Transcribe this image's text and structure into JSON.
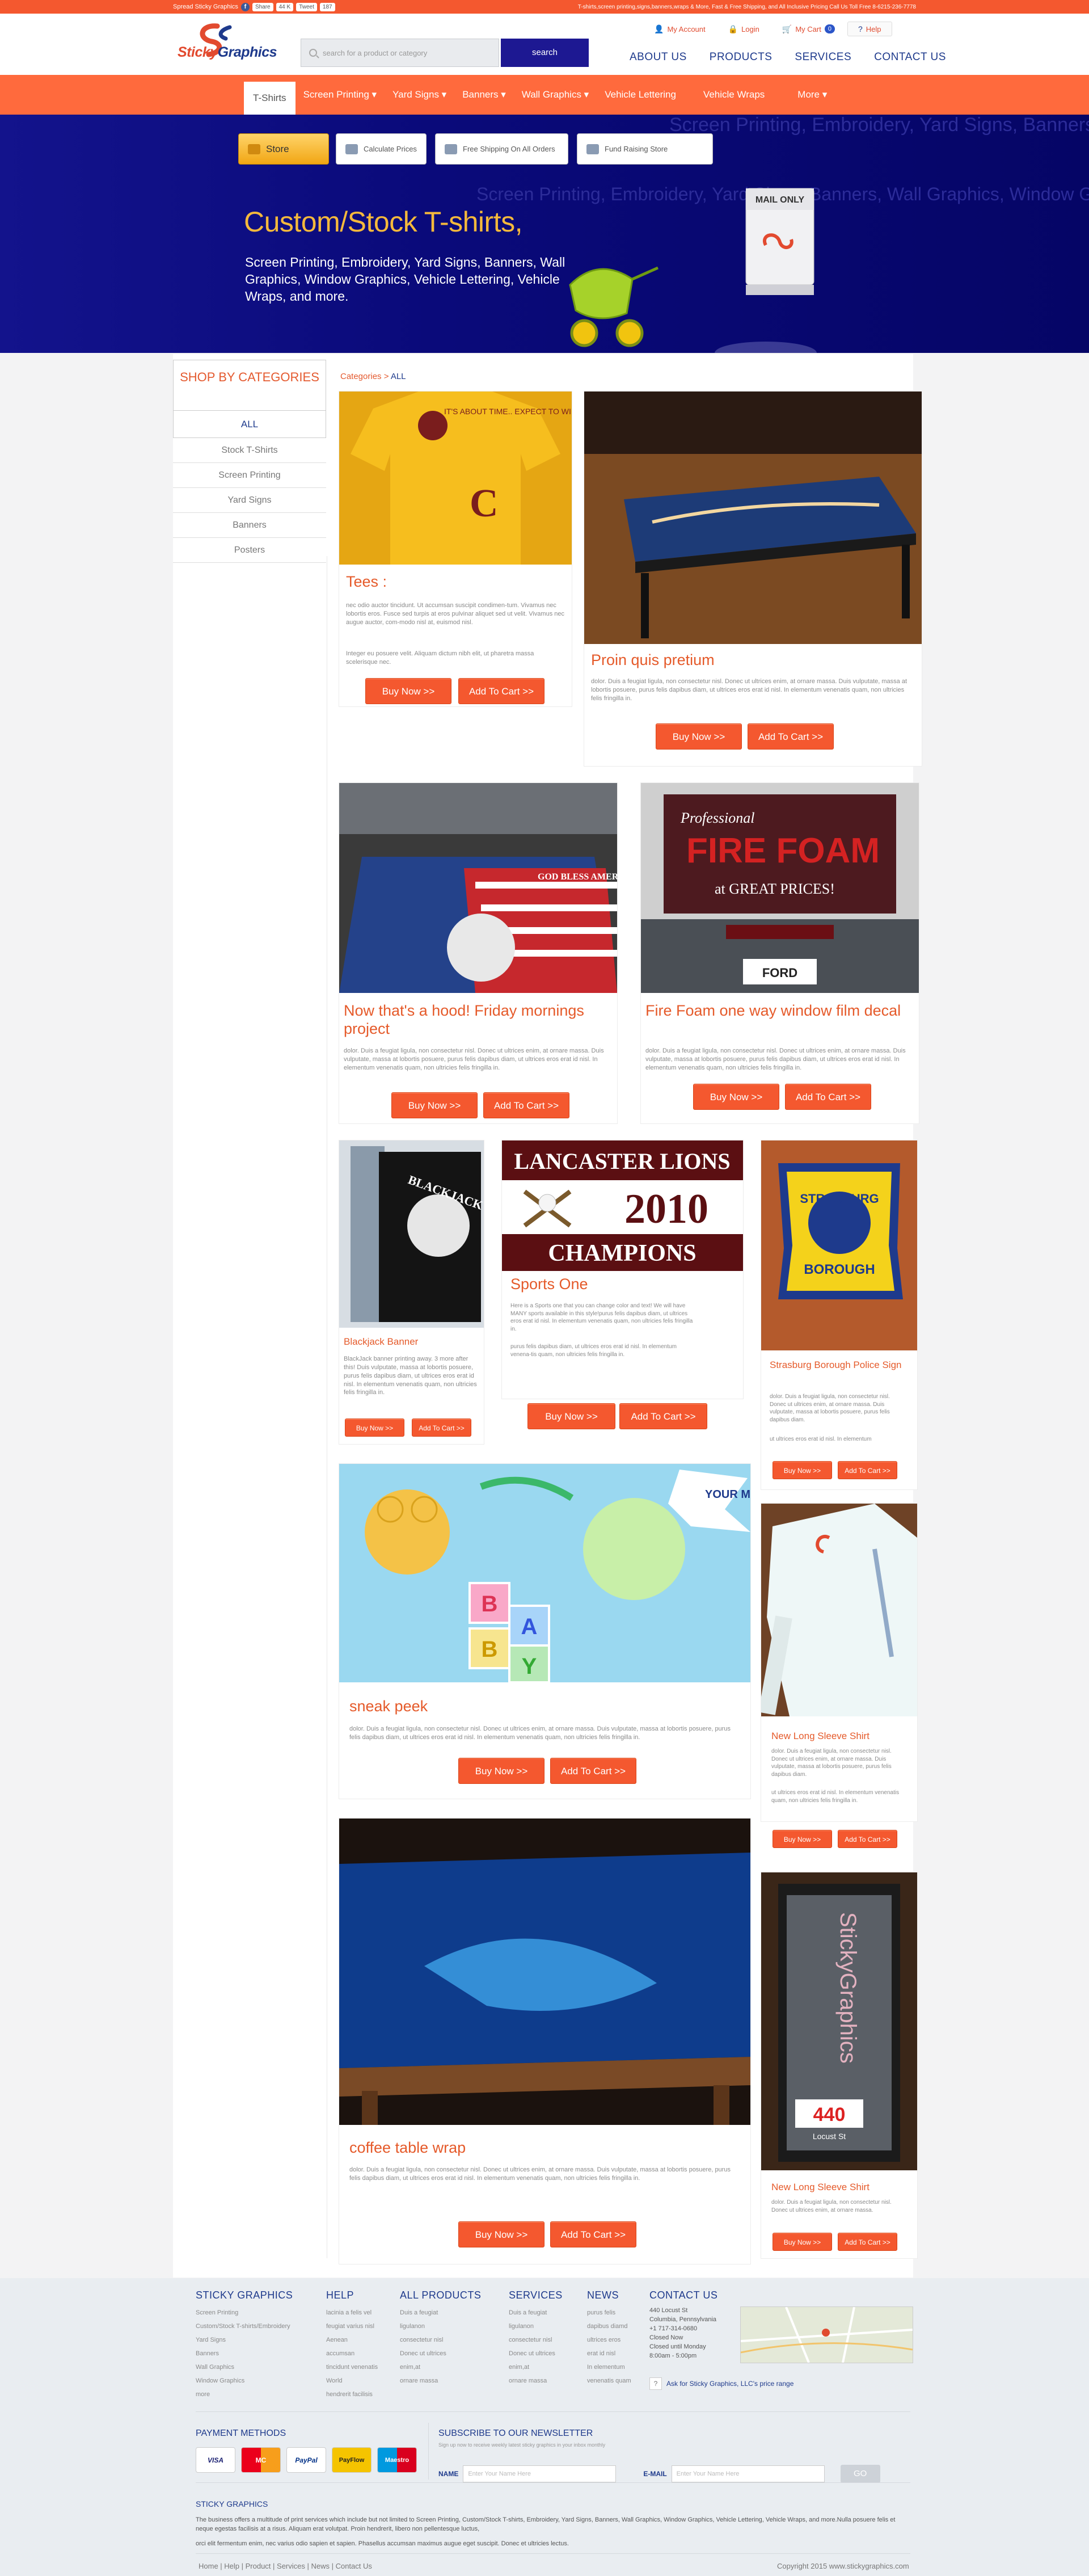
{
  "topbar": {
    "brand": "Spread Sticky Graphics",
    "like_label": "Share",
    "like_count": "44 K",
    "tweet_label": "Tweet",
    "tweet_count": "187",
    "promo": "T-shirts,screen printing,signs,banners,wraps & More, Fast & Free Shipping, and All Inclusive Pricing Call Us Toll Free 8-6215-236-7778"
  },
  "header": {
    "logo_main": "Sticky",
    "logo_accent": "Graphics",
    "search_placeholder": "search for a product or category",
    "search_button": "search",
    "my_account": "My Account",
    "login": "Login",
    "my_cart": "My Cart",
    "cart_count": "0",
    "help": "Help",
    "nav": [
      "ABOUT US",
      "PRODUCTS",
      "SERVICES",
      "CONTACT US"
    ]
  },
  "catnav": {
    "items": [
      "T-Shirts",
      "Screen Printing ▾",
      "Yard Signs ▾",
      "Banners ▾",
      "Wall Graphics ▾",
      "Vehicle Lettering",
      "Vehicle Wraps",
      "More ▾"
    ]
  },
  "hero": {
    "buttons": [
      "Store",
      "Calculate Prices",
      "Free Shipping On All Orders",
      "Fund Raising Store"
    ],
    "headline": "Custom/Stock T-shirts,",
    "sub": "Screen Printing,  Embroidery, Yard Signs, Banners, Wall Graphics, Window Graphics, Vehicle Lettering, Vehicle Wraps, and more.",
    "mailbox_label": "MAIL ONLY"
  },
  "sidebar": {
    "head": "SHOP BY CATEGORIES",
    "all": "ALL",
    "items": [
      "Stock T-Shirts",
      "Screen Printing",
      "Yard Signs",
      "Banners",
      "Posters"
    ]
  },
  "breadcrumb": {
    "root": "Categories",
    "sep": " > ",
    "current": "ALL"
  },
  "buttons": {
    "buy": "Buy Now >>",
    "cart": "Add To Cart >>"
  },
  "products": [
    {
      "title": "Tees :",
      "desc": "nec odio auctor tincidunt. Ut accumsan suscipit condimen-tum. Vivamus nec lobortis eros. Fusce sed turpis at eros pulvinar aliquet sed ut velit. Vivamus nec augue auctor, com-modo nisl at, euismod nisl.",
      "desc2": "Integer eu posuere velit. Aliquam dictum nibh elit, ut pharetra massa scelerisque nec."
    },
    {
      "title": "Proin quis pretium",
      "desc": "dolor. Duis a feugiat ligula, non consectetur nisl. Donec ut ultrices enim, at ornare massa. Duis vulputate, massa at lobortis posuere, purus felis dapibus diam, ut ultrices eros erat id nisl. In elementum venenatis quam, non ultricies felis fringilla in."
    },
    {
      "title": "Now that's a hood! Friday mornings project",
      "desc": "dolor. Duis a feugiat ligula, non consectetur nisl. Donec ut ultrices enim, at ornare massa. Duis vulputate, massa at lobortis posuere, purus felis dapibus diam, ut ultrices eros erat id nisl. In elementum venenatis quam, non ultricies felis fringilla in."
    },
    {
      "title": "Fire Foam one way window film decal",
      "desc": "dolor. Duis a feugiat ligula, non consectetur nisl. Donec ut ultrices enim, at ornare massa. Duis vulputate, massa at lobortis posuere, purus felis dapibus diam, ut ultrices eros erat id nisl. In elementum venenatis quam, non ultricies felis fringilla in."
    },
    {
      "title": "Blackjack Banner",
      "desc": "BlackJack banner printing away. 3 more after this! Duis vulputate, massa at lobortis posuere, purus felis dapibus diam, ut ultrices eros erat id nisl. In elementum venenatis quam, non ultricies felis fringilla in."
    },
    {
      "title": "Sports One",
      "desc": "Here is a Sports one that you can change color and text! We will have MANY sports available in this style!purus felis dapibus diam, ut ultrices eros erat id nisl. In elementum venenatis quam, non ultricies felis fringilla in.",
      "desc2": "purus felis dapibus diam, ut ultrices eros erat id nisl. In elementum venena-tis quam, non ultricies felis fringilla in."
    },
    {
      "title": "Strasburg Borough Police Sign",
      "desc": "dolor. Duis a feugiat ligula, non consectetur nisl. Donec ut ultrices enim, at ornare massa. Duis vulputate, massa at lobortis posuere, purus felis dapibus diam.",
      "desc2": "ut ultrices eros erat id nisl. In elementum"
    },
    {
      "title": "sneak peek",
      "desc": "dolor. Duis a feugiat ligula, non consectetur nisl. Donec ut ultrices enim, at ornare massa. Duis vulputate, massa at lobortis posuere, purus felis dapibus diam, ut ultrices eros erat id nisl. In elementum venenatis quam, non ultricies felis fringilla in."
    },
    {
      "title": "New Long Sleeve Shirt",
      "desc": "dolor. Duis a feugiat ligula, non consectetur nisl. Donec ut ultrices enim, at ornare massa. Duis vulputate, massa at lobortis posuere, purus felis dapibus diam.",
      "desc2": "ut ultrices eros erat id nisl. In elementum venenatis quam, non ultricies felis fringilla in."
    },
    {
      "title": "coffee table wrap",
      "desc": "dolor. Duis a feugiat ligula, non consectetur nisl. Donec ut ultrices enim, at ornare massa. Duis vulputate, massa at lobortis posuere, purus felis dapibus diam, ut ultrices eros erat id nisl. In elementum venenatis quam, non ultricies felis fringilla in."
    },
    {
      "title": "New Long Sleeve Shirt",
      "desc": "dolor. Duis a feugiat ligula, non consectetur nisl. Donec ut ultrices enim, at ornare massa."
    }
  ],
  "images": {
    "tee_text": "IT'S ABOUT TIME.. EXPECT TO WIN",
    "hood_text": "GOD BLESS AMERICA",
    "firefoam_top": "Professional",
    "firefoam_main": "FIRE FOAM",
    "firefoam_sub": "at GREAT PRICES!",
    "blackjack_text": "BLACKJACK",
    "lancaster_top": "LANCASTER LIONS",
    "lancaster_year": "2010",
    "lancaster_bottom": "CHAMPIONS",
    "strasburg_top": "STRASBURG",
    "strasburg_bottom": "BOROUGH",
    "baby_message": "YOUR MESSAGE",
    "baby_blocks": [
      "B",
      "A",
      "B",
      "Y"
    ],
    "door_text": "StickyGraphics",
    "door_number": "440",
    "door_street": "Locust St",
    "car_plate": "FORD"
  },
  "footer": {
    "cols": [
      {
        "head": "STICKY GRAPHICS",
        "links": [
          "Screen Printing",
          "Custom/Stock T-shirts/Embroidery",
          "Yard Signs",
          "Banners",
          "Wall Graphics",
          "Window Graphics",
          "more"
        ]
      },
      {
        "head": "HELP",
        "links": [
          "lacinia a felis vel",
          "feugiat varius nisl",
          "Aenean",
          "accumsan",
          "tincidunt venenatis",
          "World",
          "hendrerit facilisis"
        ]
      },
      {
        "head": "ALL PRODUCTS",
        "links": [
          "Duis a feugiat",
          "ligulanon",
          "consectetur nisl",
          "Donec ut ultrices",
          "enim,at",
          "ornare massa"
        ]
      },
      {
        "head": "SERVICES",
        "links": [
          "Duis a feugiat",
          "ligulanon",
          "consectetur nisl",
          "Donec ut ultrices",
          "enim,at",
          "ornare massa"
        ]
      },
      {
        "head": "NEWS",
        "links": [
          "purus felis",
          "dapibus diamd",
          "ultrices eros",
          "erat id nisl",
          "In elementum",
          "venenatis quam"
        ]
      }
    ],
    "contact_head": "CONTACT US",
    "contact_lines": [
      "440 Locust St",
      "Columbia, Pennsylvania",
      "+1 717-314-0680",
      "Closed Now",
      "Closed until Monday",
      "8:00am - 5:00pm"
    ],
    "ask": "Ask for Sticky Graphics, LLC's price range",
    "pay_head": "PAYMENT METHODS",
    "pay_cards": [
      "VISA",
      "MC",
      "PayPal",
      "PayFlow",
      "Maestro"
    ],
    "news_head": "SUBSCRIBE TO OUR NEWSLETTER",
    "news_sub": "Sign up now to receive weekly latest sticky graphics in your inbox monthly",
    "name_label": "NAME",
    "name_placeholder": "Enter Your Name Here",
    "email_label": "E-MAIL",
    "email_placeholder": "Enter Your Name Here",
    "go": "GO",
    "about_head": "STICKY GRAPHICS",
    "about_text": "The business offers a multitude of print services which include but not limited to Screen Printing, Custom/Stock T-shirts, Embroidery, Yard Signs, Banners, Wall Graphics, Window Graphics, Vehicle Lettering, Vehicle Wraps, and more.Nulla posuere felis et neque egestas facilisis at a risus. Aliquam erat volutpat. Proin hendrerit, libero non pellentesque luctus,",
    "about_text2": "orci elit fermentum enim, nec varius odio sapien et sapien. Phasellus accumsan maximus augue eget suscipit. Donec et ultricies lectus.",
    "bottom_links": "Home | Help | Product | Services | News | Contact Us",
    "copyright": "Copyright 2015 www.stickygraphics.com"
  },
  "colors": {
    "accent": "#f4582f",
    "brand": "#1e3a8c",
    "hero": "#0a0a78"
  }
}
